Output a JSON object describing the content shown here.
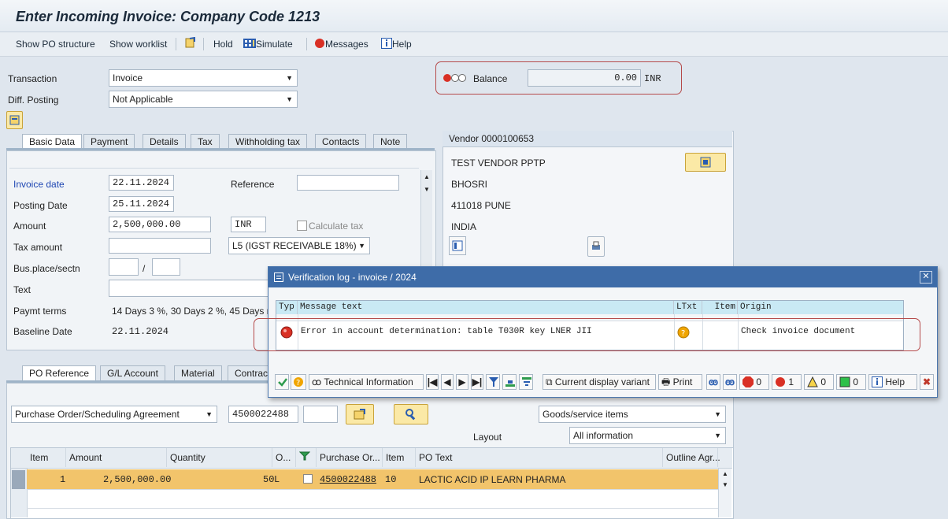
{
  "title": "Enter Incoming Invoice: Company Code 1213",
  "toolbar": {
    "show_po_structure": "Show PO structure",
    "show_worklist": "Show worklist",
    "hold": "Hold",
    "simulate": "Simulate",
    "messages": "Messages",
    "help": "Help"
  },
  "header": {
    "transaction_label": "Transaction",
    "transaction_value": "Invoice",
    "diff_posting_label": "Diff. Posting",
    "diff_posting_value": "Not Applicable",
    "balance_label": "Balance",
    "balance_value": "0.00",
    "balance_currency": "INR"
  },
  "tabs": [
    "Basic Data",
    "Payment",
    "Details",
    "Tax",
    "Withholding tax",
    "Contacts",
    "Note"
  ],
  "basic": {
    "invoice_date_label": "Invoice date",
    "invoice_date": "22.11.2024",
    "reference_label": "Reference",
    "posting_date_label": "Posting Date",
    "posting_date": "25.11.2024",
    "amount_label": "Amount",
    "amount": "2,500,000.00",
    "currency": "INR",
    "calculate_tax": "Calculate tax",
    "tax_amount_label": "Tax amount",
    "tax_code": "L5 (IGST RECEIVABLE 18%)",
    "bus_place_label": "Bus.place/sectn",
    "bus_sep": "/",
    "text_label": "Text",
    "paymt_terms_label": "Paymt terms",
    "paymt_terms": "14 Days 3 %, 30 Days 2 %, 45 Days n",
    "baseline_label": "Baseline Date",
    "baseline_date": "22.11.2024"
  },
  "vendor": {
    "title": "Vendor 0000100653",
    "name": "TEST VENDOR PPTP",
    "street": "BHOSRI",
    "city": "411018 PUNE",
    "country": "INDIA"
  },
  "po_tabs": [
    "PO Reference",
    "G/L Account",
    "Material",
    "Contract"
  ],
  "po": {
    "ref_type": "Purchase Order/Scheduling Agreement",
    "po_number": "4500022488",
    "goods_items": "Goods/service items",
    "layout_label": "Layout",
    "layout_value": "All information",
    "columns": [
      "Item",
      "Amount",
      "Quantity",
      "O...",
      "Purchase Or...",
      "Item",
      "PO Text",
      "Outline Agr..."
    ],
    "rows": [
      {
        "item": "1",
        "amount": "2,500,000.00",
        "quantity": "50",
        "unit": "L",
        "po": "4500022488",
        "po_item": "10",
        "text": "LACTIC ACID IP LEARN PHARMA"
      }
    ]
  },
  "dialog": {
    "title": "Verification log - invoice  / 2024",
    "columns": [
      "Typ",
      "Message text",
      "LTxt",
      "Item",
      "Origin"
    ],
    "message": "Error in account determination: table T030R key LNER JII",
    "origin": "Check invoice document",
    "buttons": {
      "technical_info": "Technical Information",
      "display_variant": "Current display variant",
      "print": "Print",
      "help": "Help",
      "count_stop": "0",
      "count_error": "1",
      "count_warning": "0",
      "count_success": "0"
    }
  },
  "colors": {
    "accent": "#3e6ca8",
    "highlight_row": "#f2c46b",
    "error": "#d93025",
    "red_box": "#b54a4a"
  }
}
